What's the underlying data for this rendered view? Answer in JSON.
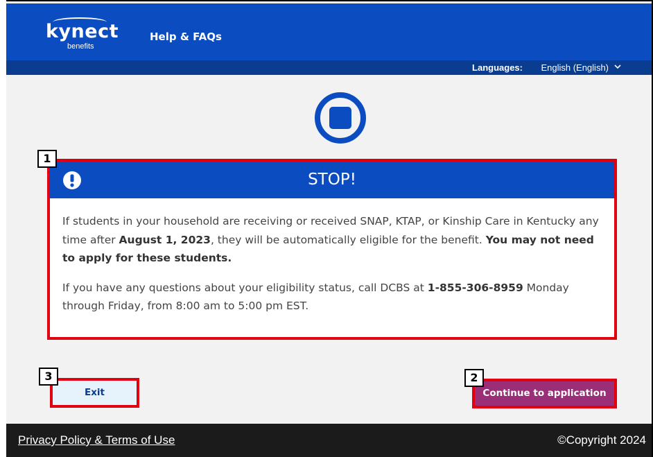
{
  "header": {
    "logo_word": "kynect",
    "logo_sub": "benefits",
    "help_link": "Help & FAQs"
  },
  "languages": {
    "label": "Languages:",
    "selected": "English (English)"
  },
  "alert": {
    "title": "STOP!",
    "para1_part1": "If students in your household are receiving or received SNAP, KTAP, or Kinship Care in Kentucky any time after ",
    "para1_date": "August 1, 2023",
    "para1_part2": ", they will be automatically eligible for the benefit. ",
    "para1_bold": "You may not need to apply for these students.",
    "para2_part1": "If you have any questions about your eligibility status, call DCBS at ",
    "para2_phone": "1-855-306-8959",
    "para2_part2": " Monday through Friday, from 8:00 am to 5:00 pm EST."
  },
  "buttons": {
    "exit": "Exit",
    "continue": "Continue to application"
  },
  "callouts": {
    "alert": "1",
    "continue": "2",
    "exit": "3"
  },
  "footer": {
    "privacy": "Privacy Policy & Terms of Use",
    "copyright": "©Copyright 2024"
  },
  "colors": {
    "primary_blue": "#0b4cc0",
    "dark_blue": "#0a3d8f",
    "callout_red": "#e00010",
    "continue_purple": "#9a2f77"
  },
  "icons": {
    "stop": "stop-circle-icon",
    "alert": "exclamation-circle-icon",
    "chevron": "chevron-down-icon"
  }
}
